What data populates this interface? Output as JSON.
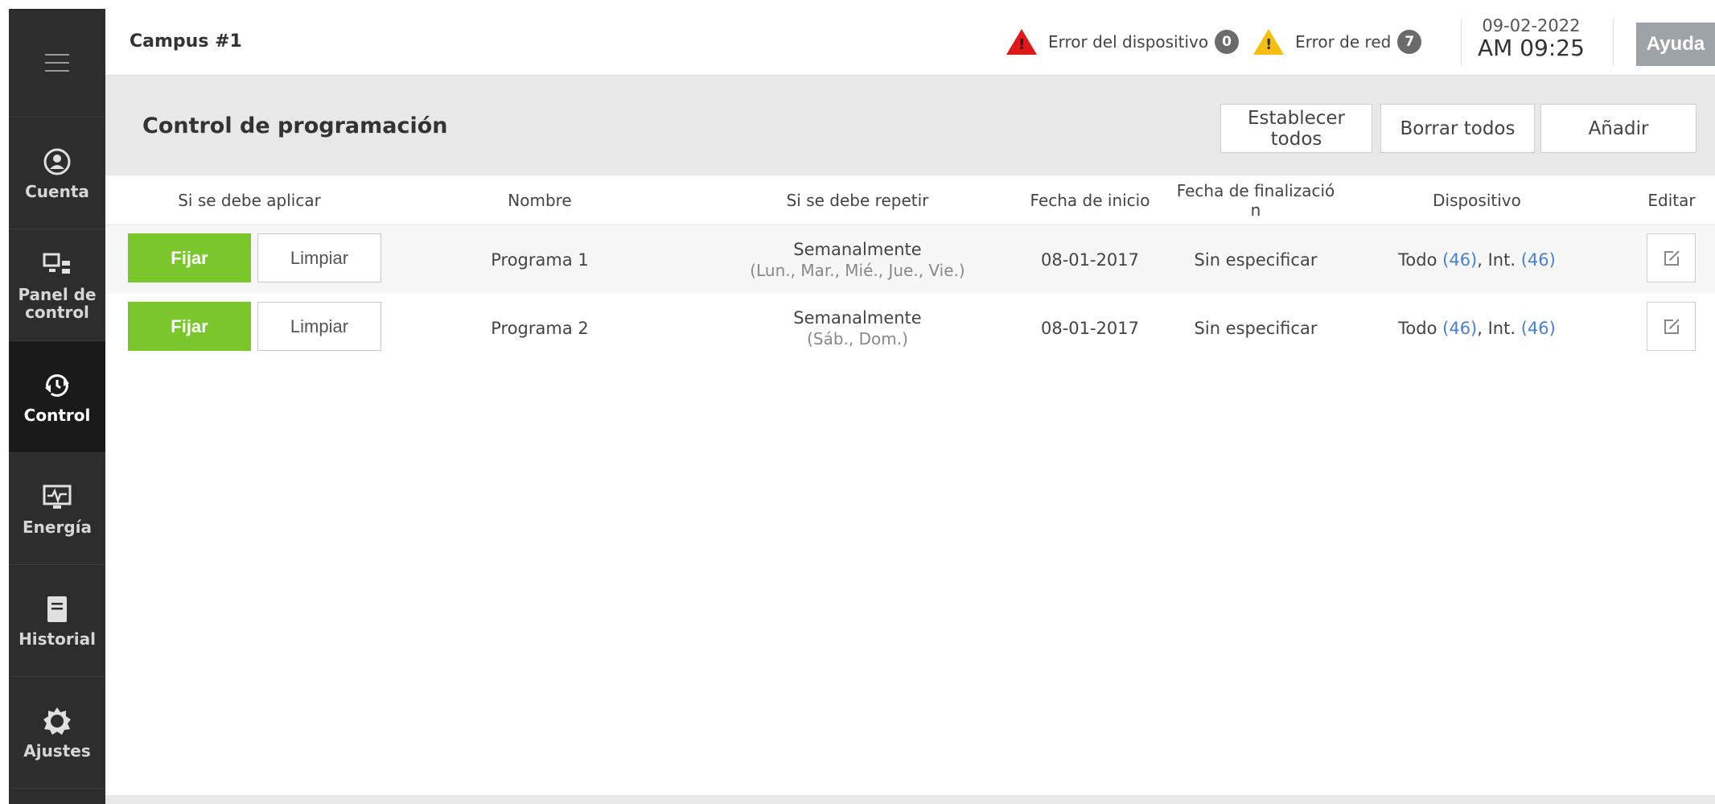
{
  "header": {
    "campus": "Campus #1",
    "device_error_label": "Error del dispositivo",
    "device_error_count": "0",
    "network_error_label": "Error de red",
    "network_error_count": "7",
    "date": "09-02-2022",
    "time": "AM 09:25",
    "help_label": "Ayuda"
  },
  "sidebar": {
    "items": [
      {
        "label": "Cuenta",
        "icon": "account-icon"
      },
      {
        "label": "Panel de control",
        "icon": "dashboard-icon"
      },
      {
        "label": "Control",
        "icon": "control-icon"
      },
      {
        "label": "Energía",
        "icon": "energy-icon"
      },
      {
        "label": "Historial",
        "icon": "history-icon"
      },
      {
        "label": "Ajustes",
        "icon": "settings-icon"
      }
    ],
    "active": "Control"
  },
  "page": {
    "title": "Control de programación",
    "set_all_label": "Establecer todos",
    "clear_all_label": "Borrar todos",
    "add_label": "Añadir"
  },
  "table": {
    "columns": [
      "Si se debe aplicar",
      "Nombre",
      "Si se debe repetir",
      "Fecha de inicio",
      "Fecha de finalizació\nn",
      "Dispositivo",
      "Editar"
    ],
    "set_label": "Fijar",
    "clear_label": "Limpiar",
    "rows": [
      {
        "name": "Programa 1",
        "repeat": "Semanalmente",
        "repeat_days": "(Lun., Mar., Mié., Jue., Vie.)",
        "start": "08-01-2017",
        "end": "Sin especificar",
        "device_all": "Todo",
        "device_all_count": "(46)",
        "device_int": "Int.",
        "device_int_count": "(46)"
      },
      {
        "name": "Programa 2",
        "repeat": "Semanalmente",
        "repeat_days": "(Sáb., Dom.)",
        "start": "08-01-2017",
        "end": "Sin especificar",
        "device_all": "Todo",
        "device_all_count": "(46)",
        "device_int": "Int.",
        "device_int_count": "(46)"
      }
    ]
  },
  "colors": {
    "sidebar_bg": "#2d2d2d",
    "active_bg": "#1a1a1a",
    "set_green": "#7ac72c",
    "link_blue": "#4a7fd1",
    "error_red": "#e01818",
    "warning_yellow": "#f6bf10",
    "help_bg": "#9ea3a8"
  }
}
